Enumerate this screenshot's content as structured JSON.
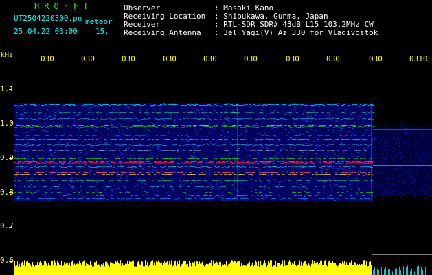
{
  "header": {
    "title": "HROFFT",
    "filename": "UT2504220300.pn",
    "date_time": "25.04.22 03:00",
    "meteor_label": "meteor",
    "meteor_count": "15.",
    "observer_label": "Observer",
    "observer_value": ": Masaki Kano",
    "location_label": "Receiving Location",
    "location_value": ": Shibukawa, Gunma, Japan",
    "receiver_label": "Receiver",
    "receiver_value": ": RTL-SDR SDR# 43dB L15 103.2MHz CW",
    "antenna_label": "Receiving Antenna",
    "antenna_value": ": 3el Yagi(V) Az 330 for Vladivostok"
  },
  "axes": {
    "y_unit": "kHz",
    "y_ticks": [
      "1.1",
      "1.0",
      "0.9",
      "0.8",
      "0.7",
      "0.6"
    ],
    "x_ticks": [
      "030",
      "030",
      "030",
      "030",
      "030",
      "030",
      "030",
      "030",
      "030",
      "0310"
    ]
  },
  "colors": {
    "axis_text": "#ffff00",
    "title": "#00ff00",
    "label": "#00ffff",
    "spectrum_bg": "#000080",
    "signal_peak": "#ff0040",
    "level_bar": "#ffff00"
  }
}
